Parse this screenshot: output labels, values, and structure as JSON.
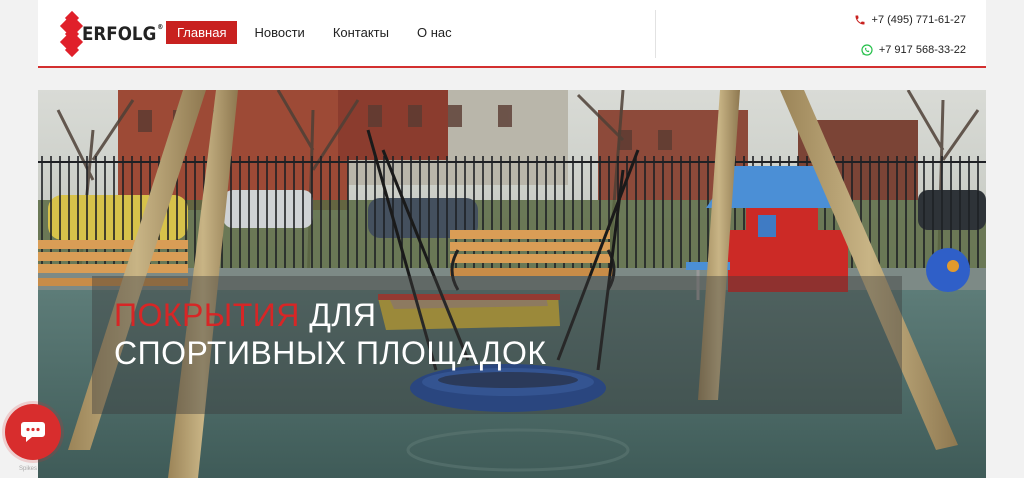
{
  "brand": {
    "name": "ERFOLG",
    "reg": "®"
  },
  "nav": {
    "items": [
      {
        "label": "Главная",
        "active": true
      },
      {
        "label": "Новости",
        "active": false
      },
      {
        "label": "Контакты",
        "active": false
      },
      {
        "label": "О нас",
        "active": false
      }
    ]
  },
  "contacts": {
    "phone": "+7 (495) 771-61-27",
    "whatsapp": "+7 917 568-33-22"
  },
  "hero": {
    "title_red": "ПОКРЫТИЯ",
    "title_rest": " ДЛЯ",
    "title_line2": "СПОРТИВНЫХ ПЛОЩАДОК"
  },
  "chat": {
    "powered": "Spikes"
  },
  "colors": {
    "accent": "#c8211f",
    "whatsapp": "#25c04a"
  }
}
